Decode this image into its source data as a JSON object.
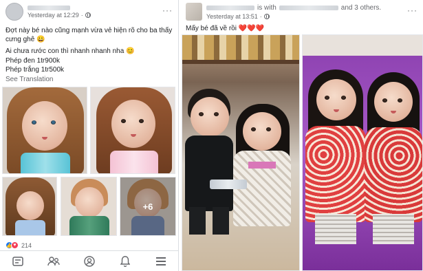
{
  "left_post": {
    "timestamp": "Yesterday at 12:29",
    "separator": "·",
    "options_label": "···",
    "line1": "Đợt này bé nào cũng mạnh vừa vẻ hiện rõ cho ba thấy cưng ghê 😀",
    "line2": "Ai chưa rước con thì nhanh nhanh nha 😊",
    "line3": "Phép đen 1tr900k",
    "line4": "Phép trắng 1tr500k",
    "see_translation": "See Translation",
    "more_photos": "+6",
    "reaction_count": "214",
    "reactions": [
      "like",
      "love"
    ]
  },
  "right_post": {
    "with_text": "is with",
    "and_others": "and 3 others.",
    "timestamp": "Yesterday at 13:51",
    "separator": "·",
    "options_label": "···",
    "caption": "Mấy bé đã về rồi ❤️❤️❤️"
  },
  "bottom_nav": {
    "items": [
      "news-feed-icon",
      "friends-icon",
      "profile-icon",
      "notifications-icon",
      "menu-icon"
    ],
    "active_color": "#1877f2",
    "inactive_color": "#65676b"
  },
  "colors": {
    "link_blue": "#1877f2",
    "secondary_text": "#65676b",
    "love_red": "#f33e58",
    "purple_couch": "#8a3fae"
  }
}
